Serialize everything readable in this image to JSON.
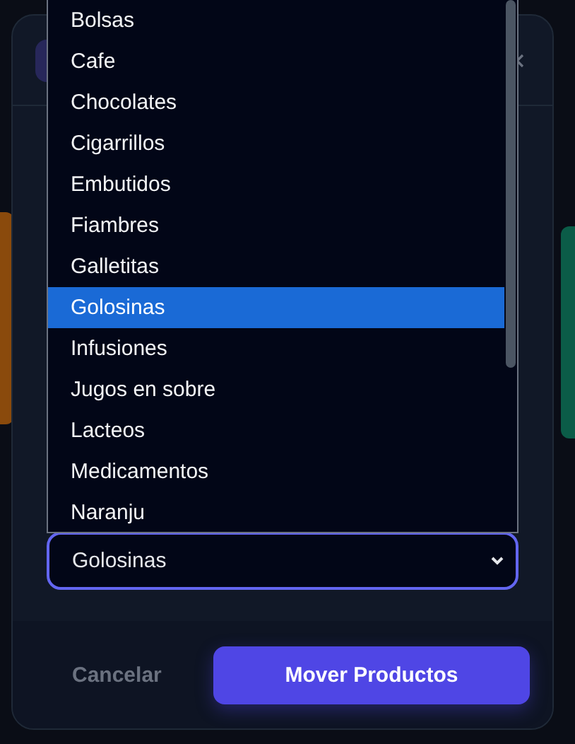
{
  "dropdown": {
    "options": [
      {
        "label": "Bolsas",
        "selected": false
      },
      {
        "label": "Cafe",
        "selected": false
      },
      {
        "label": "Chocolates",
        "selected": false
      },
      {
        "label": "Cigarrillos",
        "selected": false
      },
      {
        "label": "Embutidos",
        "selected": false
      },
      {
        "label": "Fiambres",
        "selected": false
      },
      {
        "label": "Galletitas",
        "selected": false
      },
      {
        "label": "Golosinas",
        "selected": true
      },
      {
        "label": "Infusiones",
        "selected": false
      },
      {
        "label": "Jugos en sobre",
        "selected": false
      },
      {
        "label": "Lacteos",
        "selected": false
      },
      {
        "label": "Medicamentos",
        "selected": false
      },
      {
        "label": "Naranju",
        "selected": false
      }
    ]
  },
  "category_select": {
    "value": "Golosinas"
  },
  "buttons": [
    {
      "label": "Cancelar",
      "kind": "secondary"
    },
    {
      "label": "Mover Productos",
      "kind": "primary"
    }
  ]
}
